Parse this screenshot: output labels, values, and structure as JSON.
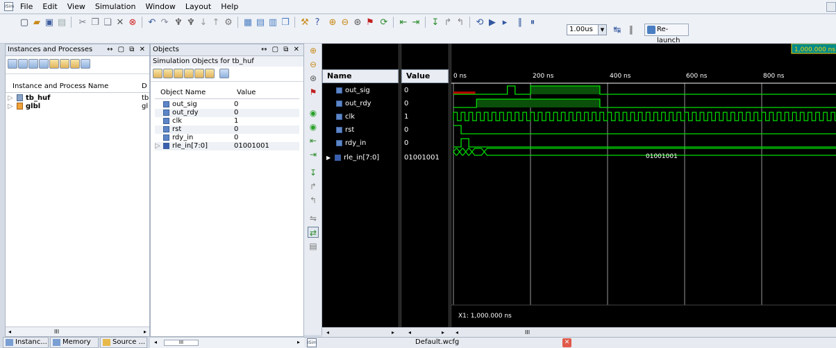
{
  "menubar": {
    "items": [
      "File",
      "Edit",
      "View",
      "Simulation",
      "Window",
      "Layout",
      "Help"
    ]
  },
  "toolbar": {
    "time_value": "1.00us",
    "relaunch_label": "Re-launch"
  },
  "instances_panel": {
    "title": "Instances and Processes",
    "col_name": "Instance and Process Name",
    "col_design": "D",
    "rows": [
      {
        "name": "tb_huf",
        "design": "tb"
      },
      {
        "name": "glbl",
        "design": "gl"
      }
    ]
  },
  "objects_panel": {
    "title": "Objects",
    "subtitle": "Simulation Objects for tb_huf",
    "col_name": "Object Name",
    "col_value": "Value",
    "rows": [
      {
        "name": "out_sig",
        "value": "0"
      },
      {
        "name": "out_rdy",
        "value": "0"
      },
      {
        "name": "clk",
        "value": "1"
      },
      {
        "name": "rst",
        "value": "0"
      },
      {
        "name": "rdy_in",
        "value": "0"
      },
      {
        "name": "rle_in[7:0]",
        "value": "01001001"
      }
    ]
  },
  "bottom_tabs": [
    "Instanc...",
    "Memory",
    "Source ..."
  ],
  "waveform": {
    "col_name": "Name",
    "col_value": "Value",
    "signals": [
      {
        "name": "out_sig",
        "value": "0"
      },
      {
        "name": "out_rdy",
        "value": "0"
      },
      {
        "name": "clk",
        "value": "1"
      },
      {
        "name": "rst",
        "value": "0"
      },
      {
        "name": "rdy_in",
        "value": "0"
      },
      {
        "name": "rle_in[7:0]",
        "value": "01001001"
      }
    ],
    "time_ticks": [
      "0 ns",
      "200 ns",
      "400 ns",
      "600 ns",
      "800 ns"
    ],
    "cursor_label": "1,000.000 ns",
    "cursor_readout": "X1: 1,000.000 ns",
    "bus_value_label": "01001001",
    "wave_color": "#00e000",
    "cursor_color": "#ffd700"
  },
  "statusbar": {
    "file_label": "Default.wcfg"
  },
  "scroll_glyph": "III"
}
